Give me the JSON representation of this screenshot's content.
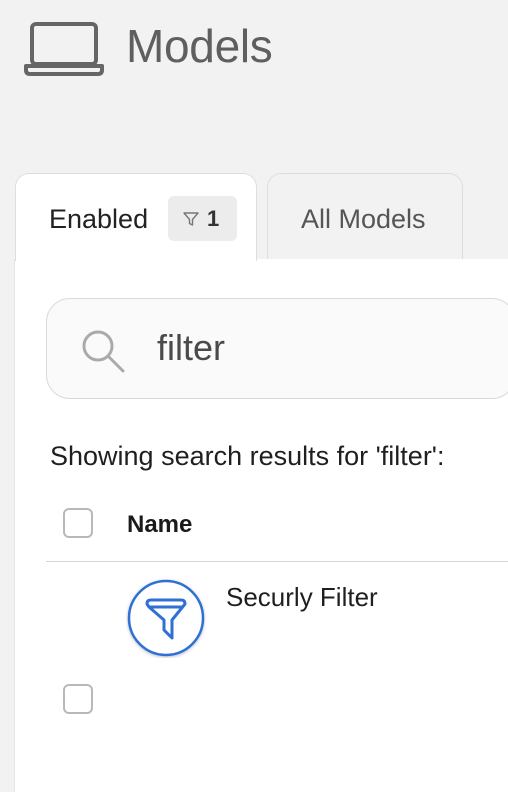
{
  "header": {
    "icon": "laptop-icon",
    "title": "Models"
  },
  "tabs": [
    {
      "label": "Enabled",
      "filter_count": "1",
      "filter_icon": "funnel-icon",
      "active": true
    },
    {
      "label": "All Models",
      "active": false
    }
  ],
  "search": {
    "icon": "search-icon",
    "value": "filter"
  },
  "results": {
    "text": "Showing search results for 'filter':"
  },
  "table": {
    "columns": [
      "Name"
    ],
    "rows": [
      {
        "name": "Securly Filter",
        "icon": "funnel-icon",
        "icon_color": "#2f6fd6"
      }
    ]
  },
  "colors": {
    "page_background": "#f2f2f2",
    "panel_background": "#ffffff",
    "accent_blue": "#2f6fd6",
    "title_gray": "#5f5f5f"
  }
}
